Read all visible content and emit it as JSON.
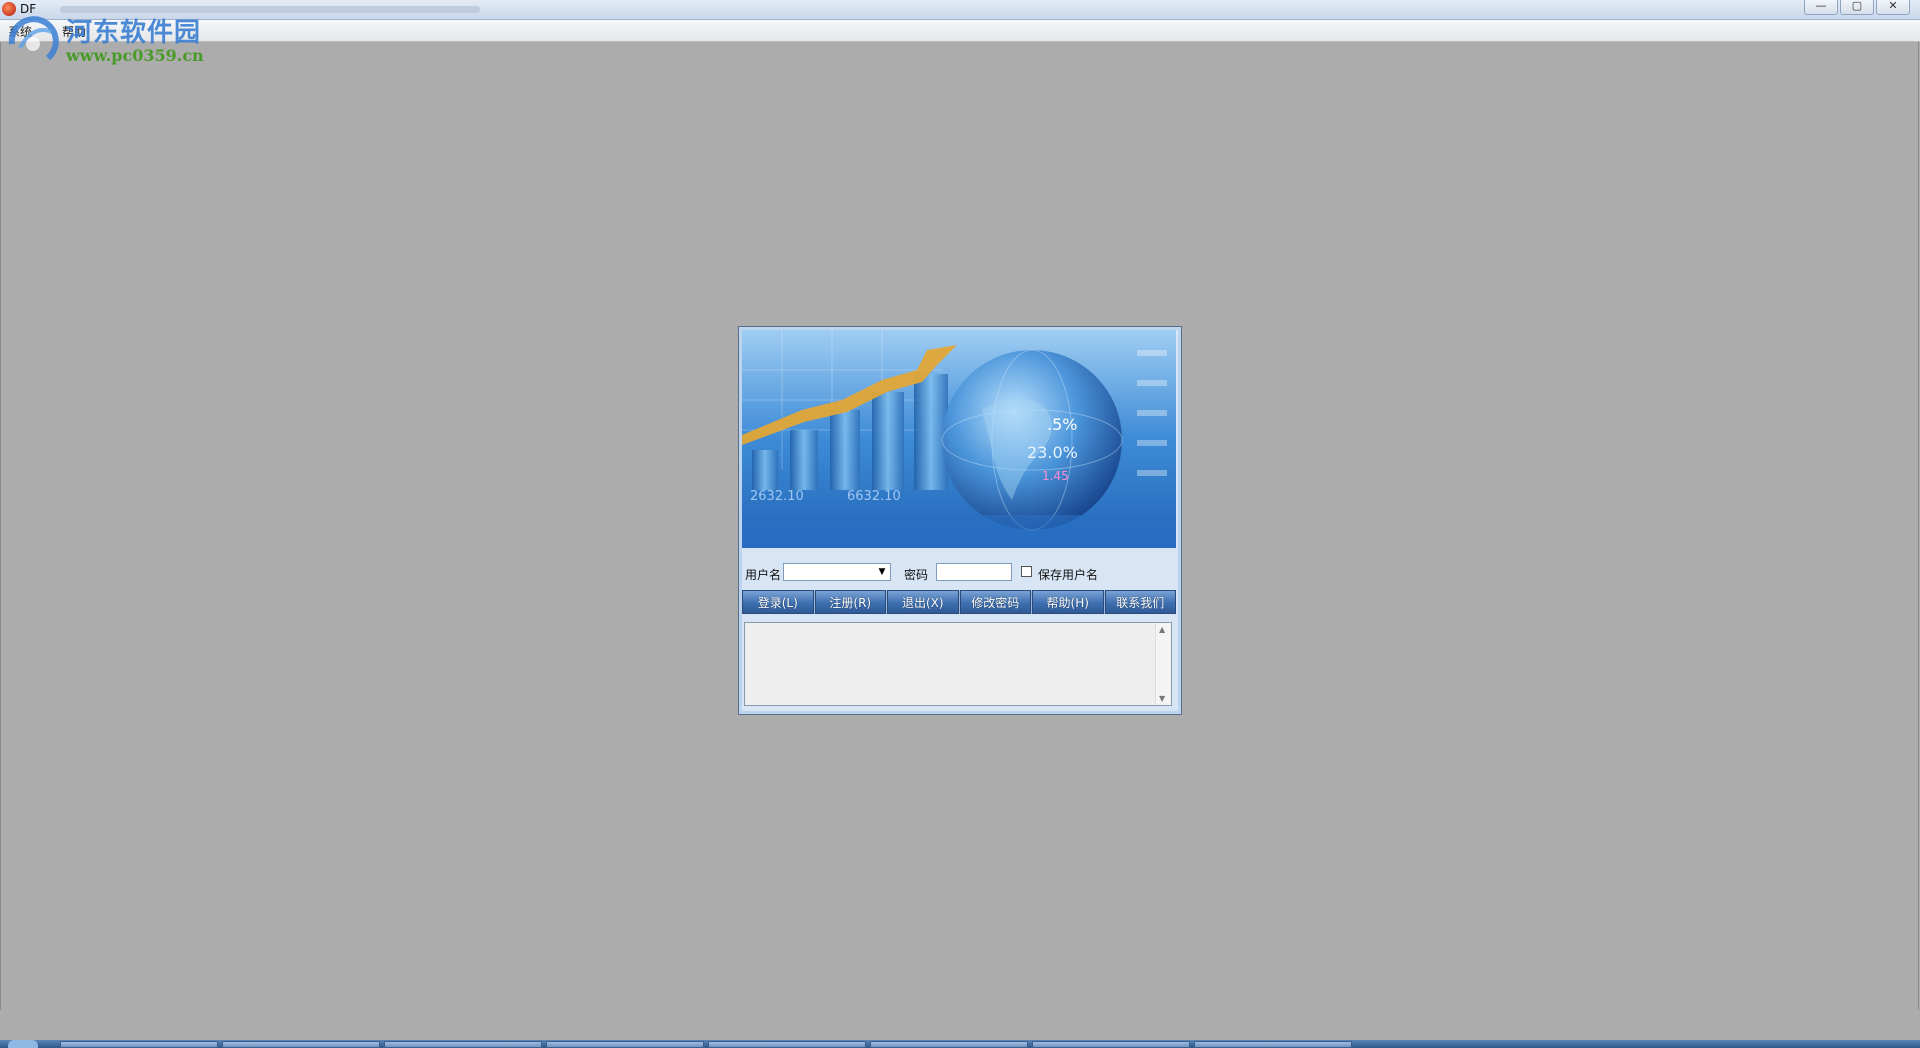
{
  "window": {
    "title": "DF",
    "controls": [
      "—",
      "▢",
      "✕"
    ]
  },
  "menubar": {
    "items": [
      "系统",
      "帮助"
    ]
  },
  "watermark": {
    "name": "河东软件园",
    "url": "www.pc0359.cn"
  },
  "login": {
    "username_label": "用户名",
    "username_value": "",
    "password_label": "密码",
    "password_value": "",
    "remember_label": "保存用户名",
    "remember_checked": false,
    "buttons": [
      "登录(L)",
      "注册(R)",
      "退出(X)",
      "修改密码",
      "帮助(H)",
      "联系我们"
    ],
    "message_text": ""
  },
  "banner": {
    "ticker_numbers": [
      ".5%",
      "23.0%",
      "1.45",
      "6632.10",
      "2632.10"
    ]
  },
  "colors": {
    "desktop": "#abacab",
    "dialog_frame": "#bcd4ee",
    "button_blue": "#3e6fb0",
    "banner_blue": "#3e8ad4"
  }
}
